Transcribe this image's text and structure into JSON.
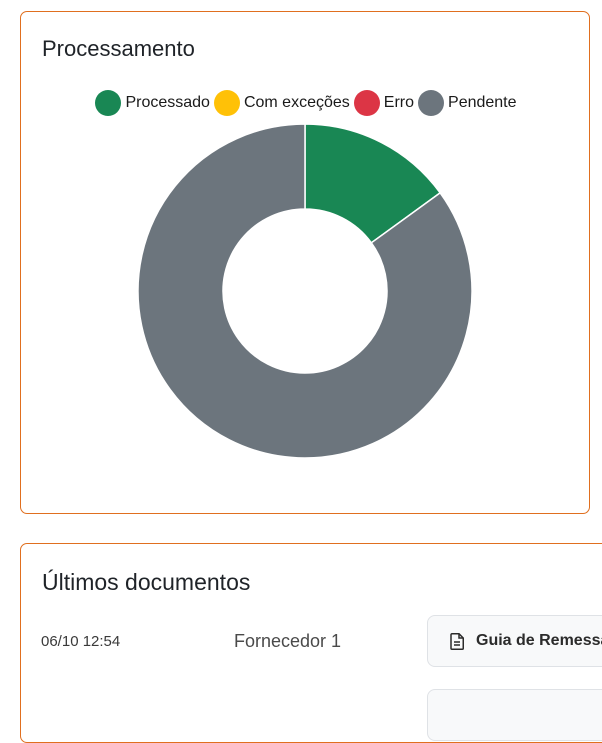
{
  "processing": {
    "title": "Processamento",
    "legend": [
      {
        "label": "Processado",
        "color": "#198754"
      },
      {
        "label": "Com exceções",
        "color": "#ffc107"
      },
      {
        "label": "Erro",
        "color": "#dc3545"
      },
      {
        "label": "Pendente",
        "color": "#6c757d"
      }
    ]
  },
  "chart_data": {
    "type": "pie",
    "variant": "doughnut",
    "categories": [
      "Processado",
      "Com exceções",
      "Erro",
      "Pendente"
    ],
    "values": [
      15,
      0,
      0,
      85
    ],
    "colors": [
      "#198754",
      "#ffc107",
      "#dc3545",
      "#6c757d"
    ],
    "legend_position": "top"
  },
  "documents": {
    "title": "Últimos documentos",
    "rows": [
      {
        "date": "06/10 12:54",
        "supplier": "Fornecedor 1",
        "doc_label": "Guia de Remessa",
        "icon": "file-text-icon"
      },
      {
        "date": "",
        "supplier": "",
        "doc_label": "",
        "icon": "file-text-icon"
      }
    ]
  }
}
